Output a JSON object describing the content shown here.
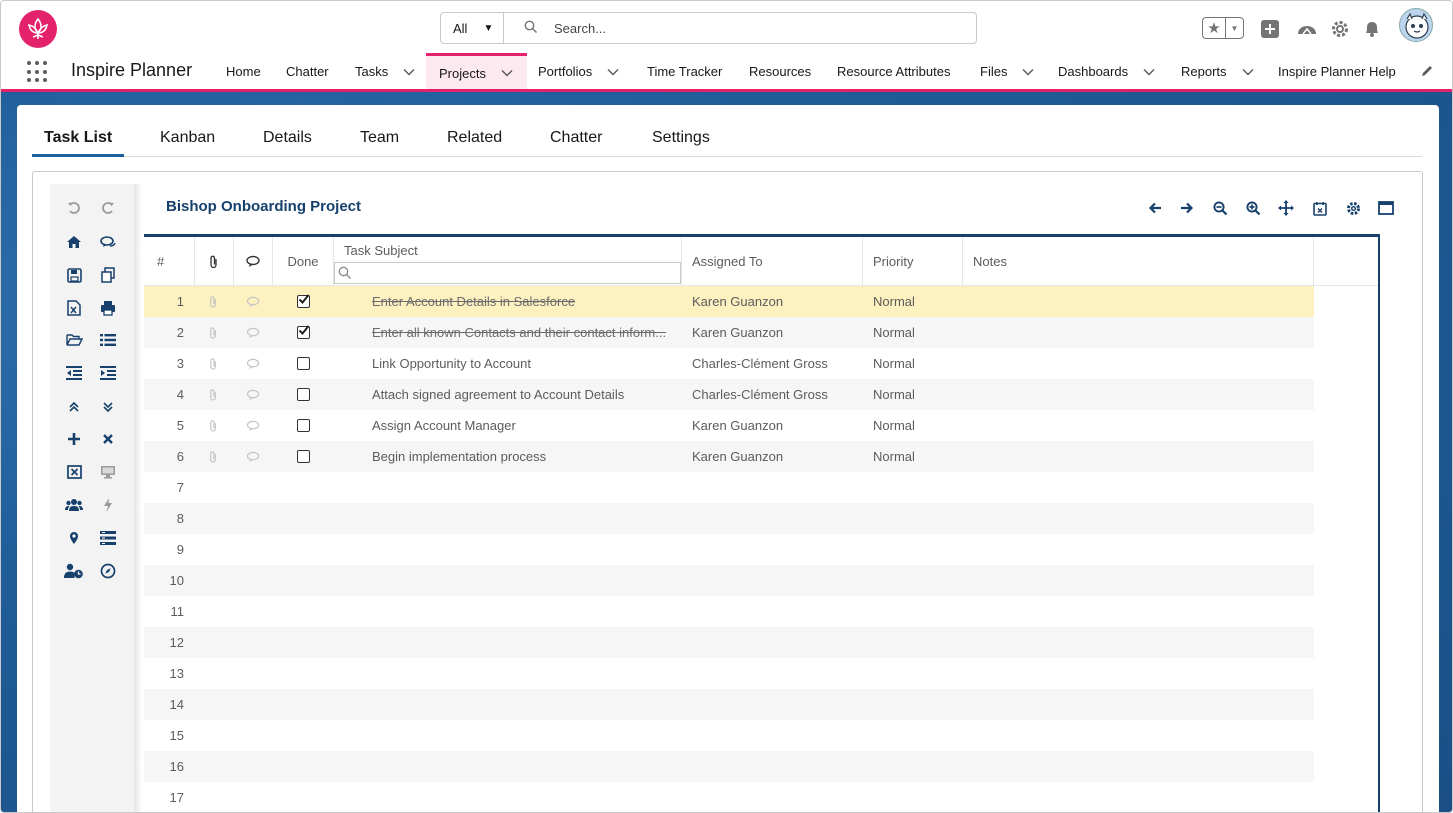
{
  "header": {
    "search_scope": "All",
    "search_placeholder": "Search..."
  },
  "nav": {
    "app_name": "Inspire Planner",
    "items": [
      {
        "label": "Home",
        "dropdown": false
      },
      {
        "label": "Chatter",
        "dropdown": false
      },
      {
        "label": "Tasks",
        "dropdown": true
      },
      {
        "label": "Projects",
        "dropdown": true,
        "active": true
      },
      {
        "label": "Portfolios",
        "dropdown": true
      },
      {
        "label": "Time Tracker",
        "dropdown": false
      },
      {
        "label": "Resources",
        "dropdown": false
      },
      {
        "label": "Resource Attributes",
        "dropdown": false
      },
      {
        "label": "Files",
        "dropdown": true
      },
      {
        "label": "Dashboards",
        "dropdown": true
      },
      {
        "label": "Reports",
        "dropdown": true
      },
      {
        "label": "Inspire Planner Help",
        "dropdown": false
      }
    ]
  },
  "tabs": [
    "Task List",
    "Kanban",
    "Details",
    "Team",
    "Related",
    "Chatter",
    "Settings"
  ],
  "active_tab": "Task List",
  "project": {
    "title": "Bishop Onboarding Project"
  },
  "grid": {
    "columns": {
      "number": "#",
      "done": "Done",
      "subject": "Task Subject",
      "assigned": "Assigned To",
      "priority": "Priority",
      "notes": "Notes"
    },
    "rows": [
      {
        "num": "1",
        "done": true,
        "subject": "Enter Account Details in Salesforce",
        "assigned": "Karen Guanzon",
        "priority": "Normal",
        "selected": true
      },
      {
        "num": "2",
        "done": true,
        "subject": "Enter all known Contacts and their contact inform...",
        "assigned": "Karen Guanzon",
        "priority": "Normal"
      },
      {
        "num": "3",
        "done": false,
        "subject": "Link Opportunity to Account",
        "assigned": "Charles-Clément Gross",
        "priority": "Normal"
      },
      {
        "num": "4",
        "done": false,
        "subject": "Attach signed agreement to Account Details",
        "assigned": "Charles-Clément Gross",
        "priority": "Normal"
      },
      {
        "num": "5",
        "done": false,
        "subject": "Assign Account Manager",
        "assigned": "Karen Guanzon",
        "priority": "Normal"
      },
      {
        "num": "6",
        "done": false,
        "subject": "Begin implementation process",
        "assigned": "Karen Guanzon",
        "priority": "Normal"
      }
    ],
    "empty_rows": [
      "7",
      "8",
      "9",
      "10",
      "11",
      "12",
      "13",
      "14",
      "15",
      "16",
      "17"
    ]
  },
  "colors": {
    "brand": "#e3226b",
    "title": "#17406d",
    "selected_row": "#fdf1c0"
  }
}
